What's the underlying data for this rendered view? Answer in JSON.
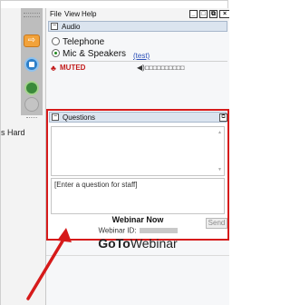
{
  "menu": {
    "file": "File",
    "view": "View",
    "help": "Help"
  },
  "window_buttons": {
    "minimize": "_",
    "maximize": "□",
    "restore": "⧉",
    "close": "×"
  },
  "left_app": {
    "text": "s Hard"
  },
  "audio": {
    "title": "Audio",
    "option_telephone": "Telephone",
    "option_mic": "Mic & Speakers",
    "test_link": "(test)",
    "selected": "Mic & Speakers",
    "muted_label": "MUTED",
    "level_meter": "◘◘◘◘◘◘◘◘◘◘"
  },
  "questions": {
    "title": "Questions",
    "input_value": "[Enter a question for staff]",
    "send_label": "Send"
  },
  "footer": {
    "status": "Webinar Now",
    "webinar_id_label": "Webinar ID:",
    "logo_bold": "GoTo",
    "logo_normal": "Webinar"
  },
  "colors": {
    "highlight": "#d61a1a",
    "muted": "#c21b1b",
    "link": "#2a4fb8",
    "section_header": "#dbe4ef"
  },
  "icons": {
    "arrow": "orange-arrow-icon",
    "screen": "blue-screen-icon",
    "globe": "globe-icon",
    "mute": "mute-icon",
    "speaker": "speaker-icon"
  }
}
